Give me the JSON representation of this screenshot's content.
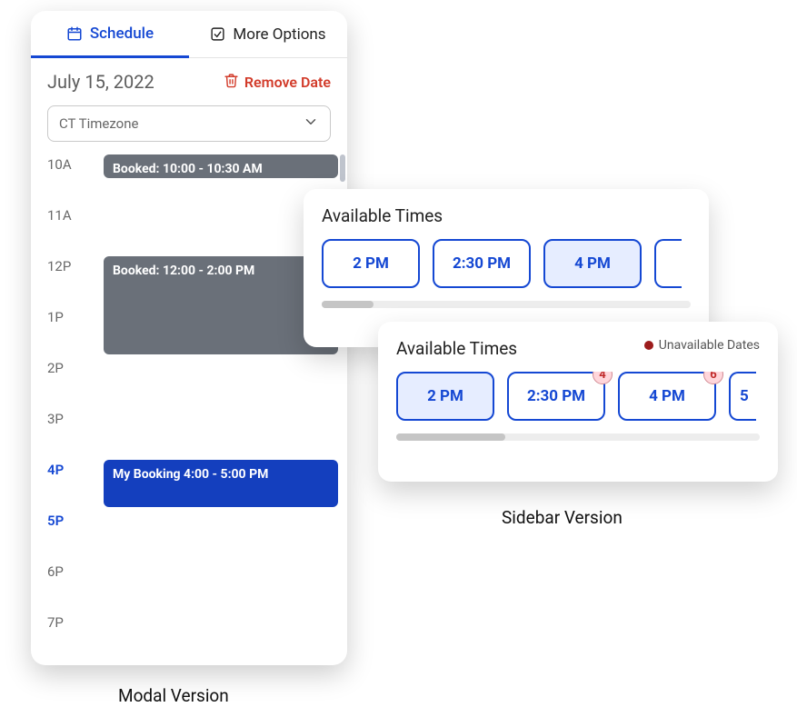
{
  "modal": {
    "tabs": {
      "schedule": "Schedule",
      "more": "More Options"
    },
    "date": "July 15, 2022",
    "remove_label": "Remove Date",
    "timezone": {
      "selected": "CT Timezone"
    },
    "hours": [
      "10A",
      "11A",
      "12P",
      "1P",
      "2P",
      "3P",
      "4P",
      "5P",
      "6P",
      "7P"
    ],
    "highlight_hours": [
      "4P",
      "5P"
    ],
    "events": [
      {
        "label": "Booked: 10:00 - 10:30 AM",
        "kind": "gray",
        "start_index": 0,
        "span": 0.5
      },
      {
        "label": "Booked: 12:00 - 2:00 PM",
        "kind": "gray",
        "start_index": 2,
        "span": 2.0
      },
      {
        "label": "My Booking 4:00 - 5:00 PM",
        "kind": "blue",
        "start_index": 6,
        "span": 1.0
      }
    ]
  },
  "sidebar_a": {
    "title": "Available Times",
    "chips": [
      {
        "label": "2 PM",
        "selected": false
      },
      {
        "label": "2:30 PM",
        "selected": false
      },
      {
        "label": "4 PM",
        "selected": true
      }
    ],
    "edge_chip": ""
  },
  "sidebar_b": {
    "title": "Available Times",
    "legend": "Unavailable Dates",
    "chips": [
      {
        "label": "2 PM",
        "selected": true
      },
      {
        "label": "2:30 PM",
        "selected": false,
        "badge": "4"
      },
      {
        "label": "4 PM",
        "selected": false,
        "badge": "6"
      }
    ],
    "edge_chip": "5",
    "scroll_thumb_width_pct": 30
  },
  "captions": {
    "modal": "Modal Version",
    "sidebar": "Sidebar Version"
  },
  "colors": {
    "accent": "#1548d3",
    "danger": "#d23b2a",
    "gray_event": "#6a7079"
  }
}
